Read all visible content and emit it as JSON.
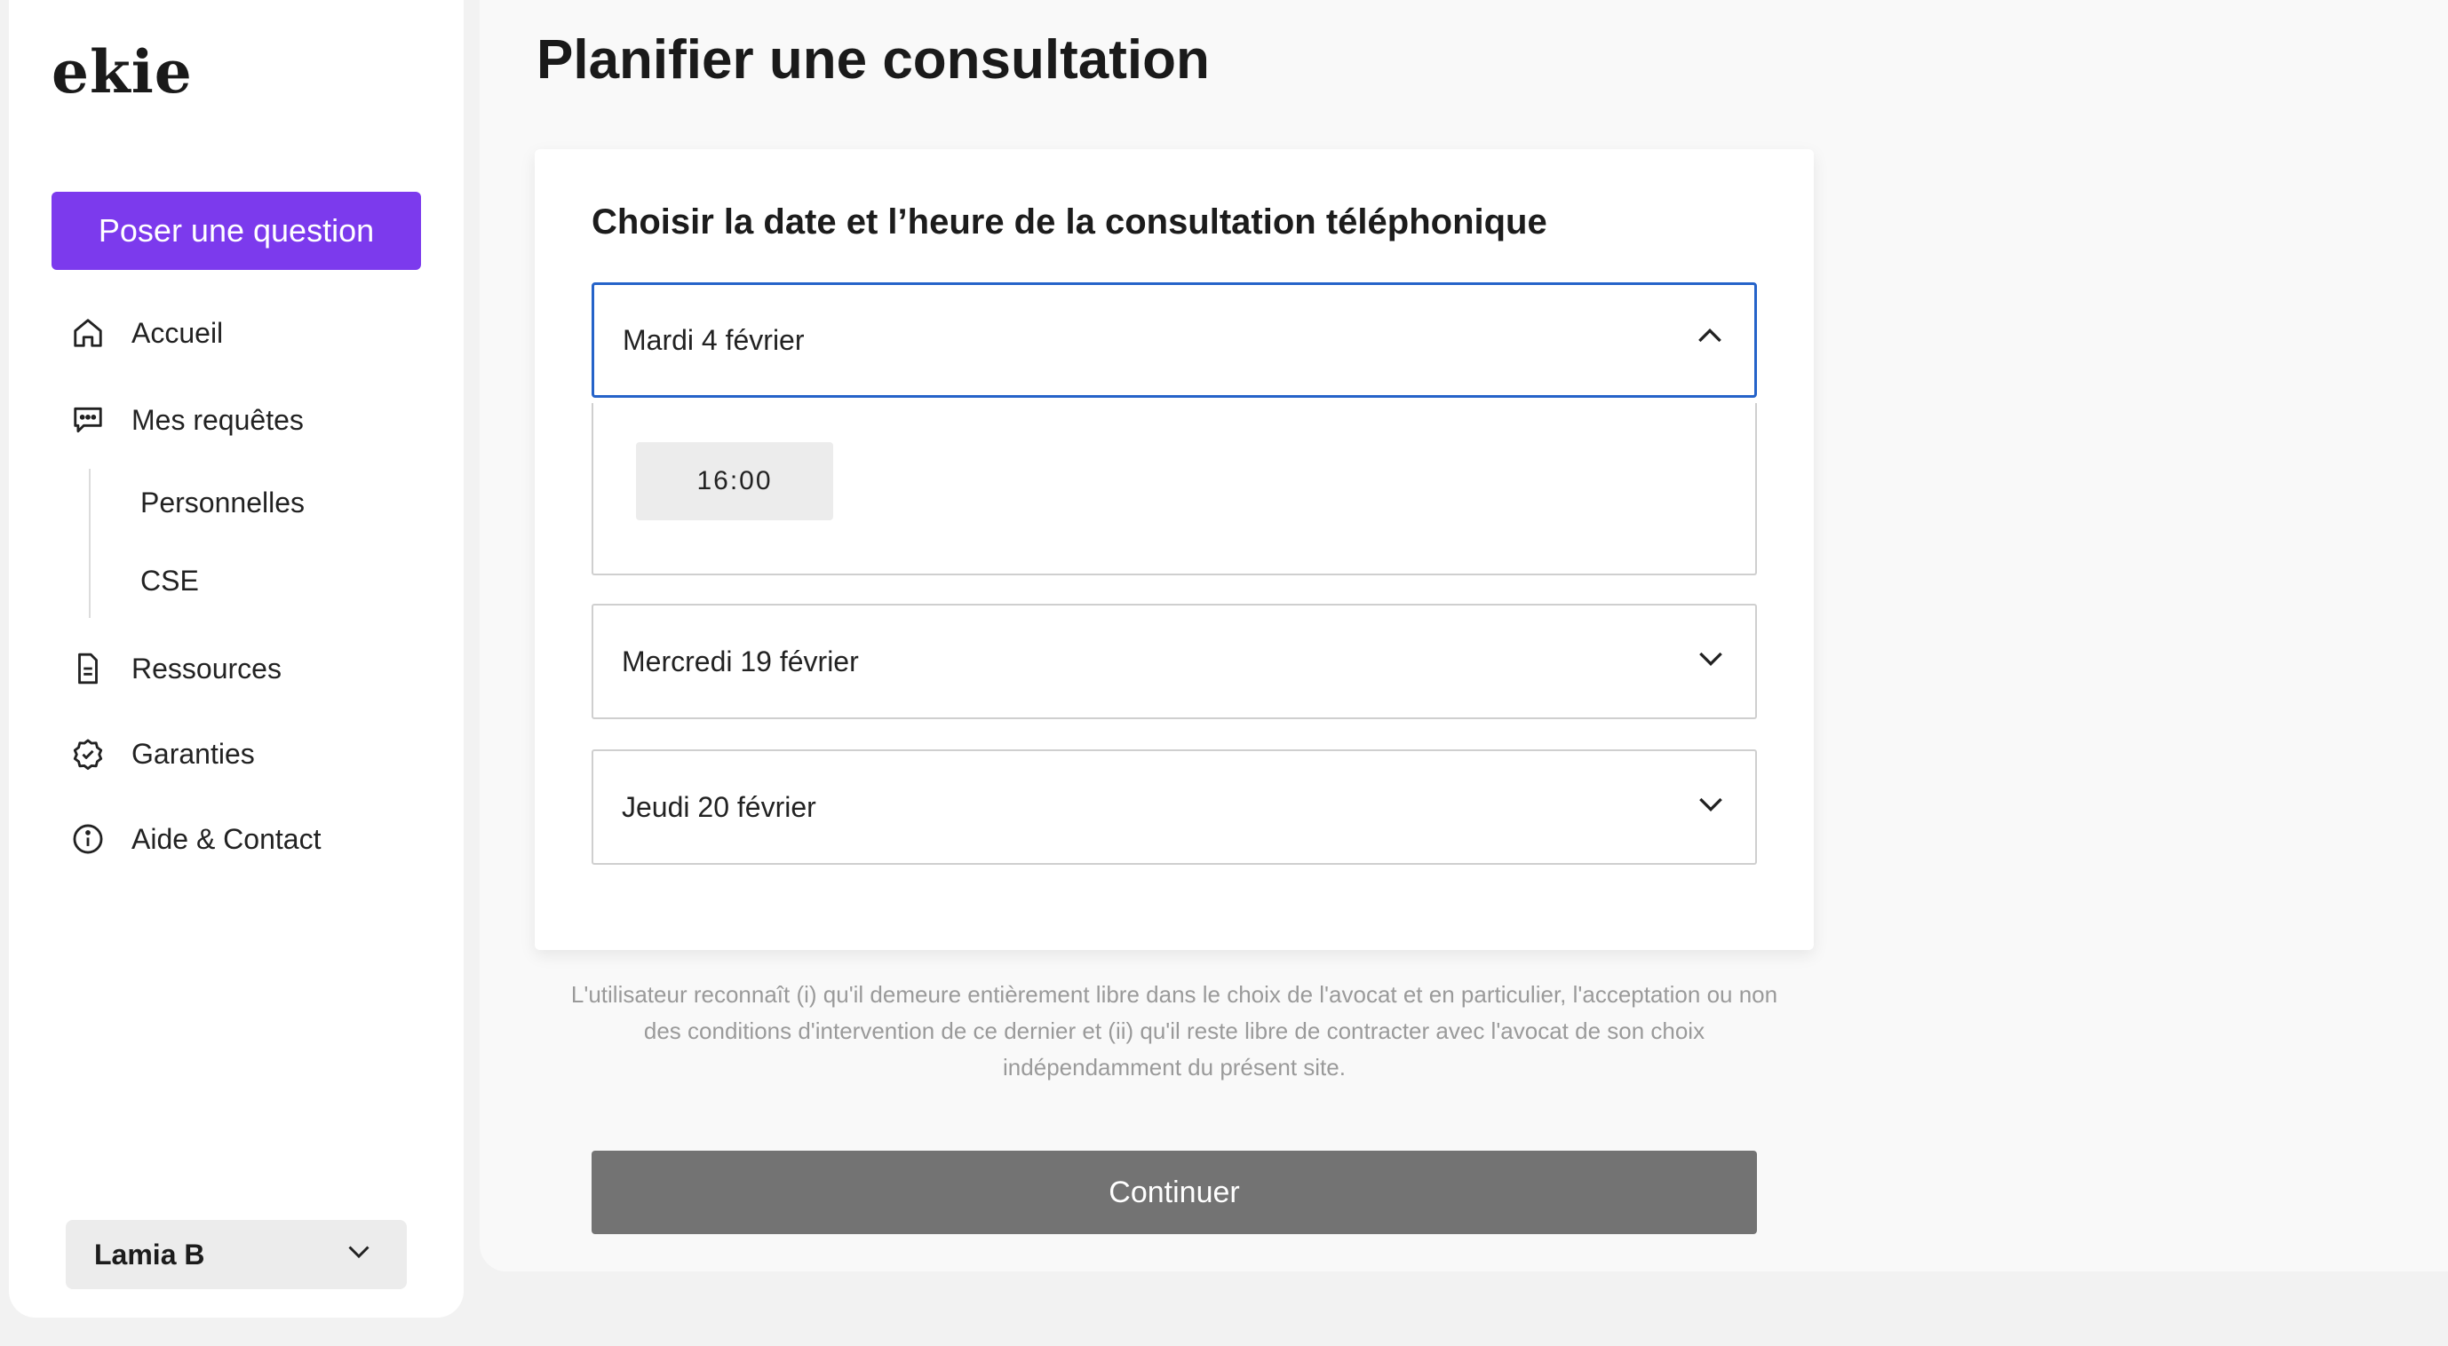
{
  "app": {
    "logo": "ekie"
  },
  "sidebar": {
    "ask_button": "Poser une question",
    "items": [
      {
        "label": "Accueil",
        "icon": "home-icon"
      },
      {
        "label": "Mes requêtes",
        "icon": "chat-icon"
      },
      {
        "label": "Ressources",
        "icon": "document-icon"
      },
      {
        "label": "Garanties",
        "icon": "badge-check-icon"
      },
      {
        "label": "Aide & Contact",
        "icon": "info-icon"
      }
    ],
    "subitems": [
      {
        "label": "Personnelles"
      },
      {
        "label": "CSE"
      }
    ],
    "user": {
      "name": "Lamia B",
      "icon": "chevron-down-icon"
    }
  },
  "main": {
    "title": "Planifier une consultation",
    "card_title": "Choisir la date et l’heure de la consultation téléphonique",
    "dates": [
      {
        "label": "Mardi 4 février",
        "expanded": true,
        "slots": [
          "16:00"
        ]
      },
      {
        "label": "Mercredi 19 février",
        "expanded": false
      },
      {
        "label": "Jeudi 20 février",
        "expanded": false
      }
    ],
    "disclaimer_lines": [
      "L'utilisateur reconnaît (i) qu'il demeure entièrement libre dans le choix de l'avocat et en particulier, l'acceptation ou non",
      "des conditions d'intervention de ce dernier et (ii) qu'il reste libre de contracter avec l'avocat de son choix",
      "indépendamment du présent site."
    ],
    "continue_button": "Continuer"
  },
  "colors": {
    "accent": "#7c3aed",
    "focus_border": "#2563c9",
    "continue_disabled": "#737373"
  }
}
